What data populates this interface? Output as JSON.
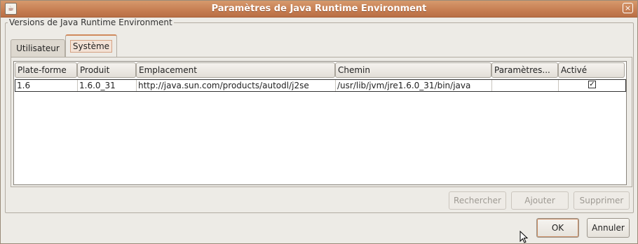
{
  "window": {
    "title": "Paramètres de Java Runtime Environment",
    "app_icon": "java-icon",
    "close_glyph": "×"
  },
  "group": {
    "legend": "Versions de Java Runtime Environment"
  },
  "tabs": [
    {
      "label": "Utilisateur",
      "selected": false
    },
    {
      "label": "Système",
      "selected": true
    }
  ],
  "table": {
    "columns": [
      "Plate-forme",
      "Produit",
      "Emplacement",
      "Chemin",
      "Paramètres...",
      "Activé"
    ],
    "rows": [
      {
        "platform": "1.6",
        "product": "1.6.0_31",
        "location": "http://java.sun.com/products/autodl/j2se",
        "path": "/usr/lib/jvm/jre1.6.0_31/bin/java",
        "parameters": "",
        "enabled": true,
        "enabled_glyph": "✓"
      }
    ]
  },
  "actions": {
    "search": "Rechercher",
    "add": "Ajouter",
    "remove": "Supprimer",
    "ok": "OK",
    "cancel": "Annuler"
  },
  "colors": {
    "titlebar": "#c67d51",
    "selected_tab_accent": "#d08a5d",
    "window_bg": "#edebe6"
  }
}
